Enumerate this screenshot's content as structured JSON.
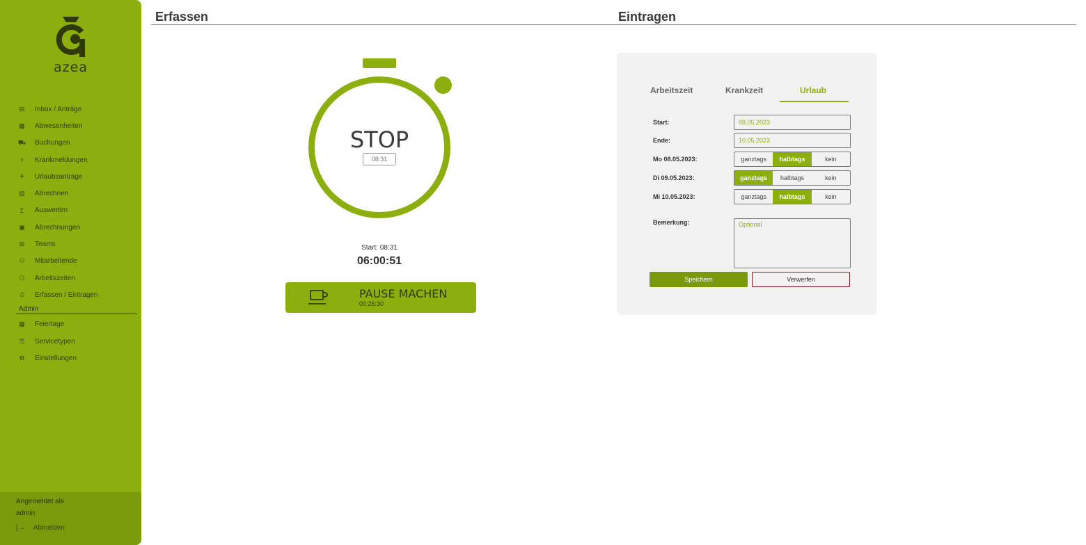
{
  "app": {
    "logo_text": "azea"
  },
  "sidebar": {
    "items": [
      {
        "label": "Inbox / Anträge",
        "icon": "inbox-icon",
        "glyph": "⊟"
      },
      {
        "label": "Abwesenheiten",
        "icon": "calendar-grid-icon",
        "glyph": "▦"
      },
      {
        "label": "Buchungen",
        "icon": "bookings-icon",
        "glyph": "⛟"
      },
      {
        "label": "Krankmeldungen",
        "icon": "stethoscope-icon",
        "glyph": "⚕"
      },
      {
        "label": "Urlaubsanträge",
        "icon": "palm-tree-icon",
        "glyph": "⚘"
      },
      {
        "label": "Abrechnen",
        "icon": "calculator-icon",
        "glyph": "▤"
      },
      {
        "label": "Auswerten",
        "icon": "sigma-icon",
        "glyph": "Σ"
      },
      {
        "label": "Abrechnungen",
        "icon": "invoice-icon",
        "glyph": "▣"
      },
      {
        "label": "Teams",
        "icon": "teams-icon",
        "glyph": "⊞"
      },
      {
        "label": "Mitarbeitende",
        "icon": "people-icon",
        "glyph": "⚇"
      },
      {
        "label": "Arbeitszeiten",
        "icon": "user-clock-icon",
        "glyph": "⚆"
      },
      {
        "label": "Erfassen / Eintragen",
        "icon": "stopwatch-icon",
        "glyph": "⏱"
      }
    ],
    "admin_label": "Admin",
    "admin_items": [
      {
        "label": "Feiertage",
        "icon": "holiday-calendar-icon",
        "glyph": "▦"
      },
      {
        "label": "Servicetypen",
        "icon": "list-icon",
        "glyph": "☰"
      },
      {
        "label": "Einstellungen",
        "icon": "gear-icon",
        "glyph": "⚙"
      }
    ],
    "footer": {
      "logged_in_as": "Angemeldet als",
      "username": "admin",
      "logout_label": "Abmelden",
      "logout_icon": "logout-icon"
    }
  },
  "erfassen": {
    "title": "Erfassen",
    "stop_label": "STOP",
    "start_time": "08:31",
    "start_text": "Start: 08:31",
    "elapsed": "06:00:51",
    "pause_label": "PAUSE MACHEN",
    "pause_duration": "00:26:30",
    "pause_icon": "coffee-cup-icon"
  },
  "eintragen": {
    "title": "Eintragen",
    "tabs": [
      {
        "label": "Arbeitszeit",
        "active": false
      },
      {
        "label": "Krankzeit",
        "active": false
      },
      {
        "label": "Urlaub",
        "active": true
      }
    ],
    "start_label": "Start:",
    "start_value": "08.05.2023",
    "end_label": "Ende:",
    "end_value": "10.05.2023",
    "days": [
      {
        "label": "Mo 08.05.2023:",
        "options": [
          "ganztags",
          "halbtags",
          "kein"
        ],
        "selected": 1
      },
      {
        "label": "Di 09.05.2023:",
        "options": [
          "ganztags",
          "halbtags",
          "kein"
        ],
        "selected": 0
      },
      {
        "label": "Mi 10.05.2023:",
        "options": [
          "ganztags",
          "halbtags",
          "kein"
        ],
        "selected": 1
      }
    ],
    "remark_label": "Bemerkung:",
    "remark_placeholder": "Optional",
    "save_label": "Speichern",
    "discard_label": "Verwerfen"
  },
  "colors": {
    "accent": "#8cae0e",
    "accent_dark": "#7a9a0c",
    "discard_border": "#8a1a1a"
  }
}
